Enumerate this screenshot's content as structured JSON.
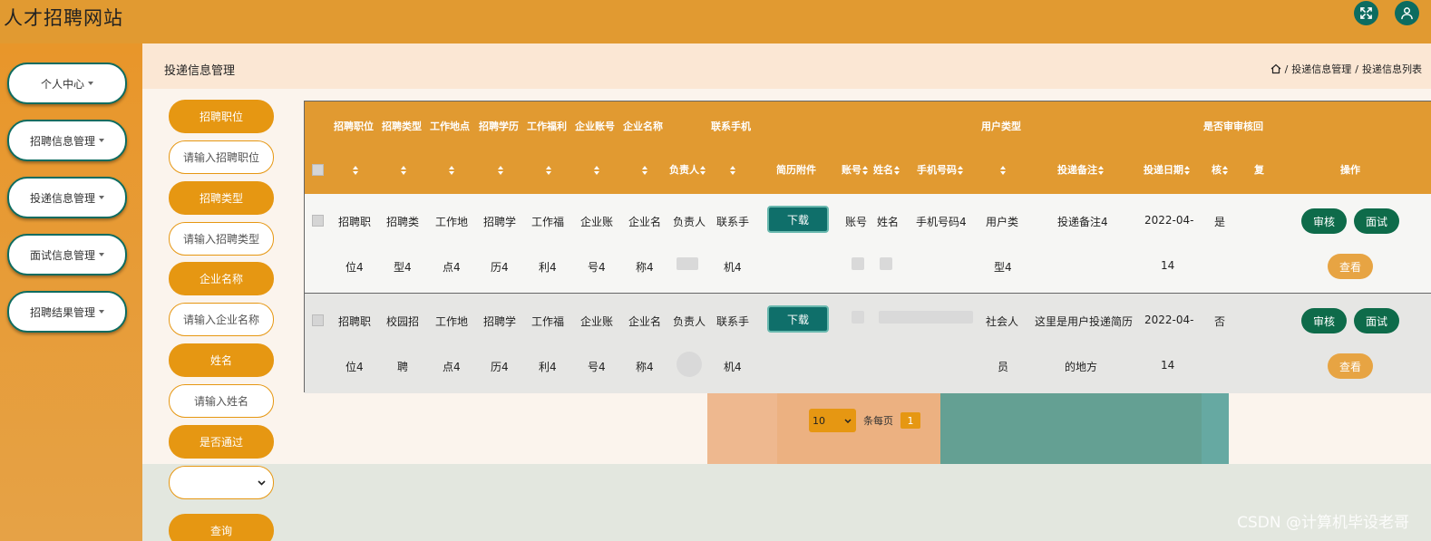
{
  "header": {
    "site_title": "人才招聘网站",
    "fullscreen_icon": "expand-icon",
    "user_icon": "user-icon"
  },
  "sidebar": {
    "items": [
      {
        "label": "个人中心"
      },
      {
        "label": "招聘信息管理"
      },
      {
        "label": "投递信息管理"
      },
      {
        "label": "面试信息管理"
      },
      {
        "label": "招聘结果管理"
      }
    ]
  },
  "page": {
    "title": "投递信息管理",
    "breadcrumb": [
      "投递信息管理",
      "投递信息列表"
    ],
    "breadcrumb_sep": "/",
    "home_icon": "home-icon"
  },
  "search": {
    "fields": [
      {
        "label": "招聘职位",
        "placeholder": "请输入招聘职位"
      },
      {
        "label": "招聘类型",
        "placeholder": "请输入招聘类型"
      },
      {
        "label": "企业名称",
        "placeholder": "请输入企业名称"
      },
      {
        "label": "姓名",
        "placeholder": "请输入姓名"
      }
    ],
    "pass_label": "是否通过",
    "pass_value": "",
    "query_button": "查询"
  },
  "table": {
    "headers_top": {
      "c1": "招聘职位",
      "c2": "招聘类型",
      "c3": "工作地点",
      "c4": "招聘学历",
      "c5": "工作福利",
      "c6": "企业账号",
      "c7": "企业名称",
      "c9": "联系手机",
      "c15": "用户类型",
      "c18": "是否审",
      "c19": "审核回"
    },
    "headers_bottom": {
      "c8": "负责人",
      "c10": "简历附件",
      "c11": "账号",
      "c12": "姓名",
      "c13": "手机号码",
      "c16": "投递备注",
      "c17": "投递日期",
      "c18": "核",
      "c19": "复",
      "c20": "操作"
    },
    "download_label": "下载",
    "actions": {
      "audit": "审核",
      "interview": "面试",
      "view": "查看"
    },
    "rows": [
      {
        "line1": [
          "招聘职",
          "招聘类",
          "工作地",
          "招聘学",
          "工作福",
          "企业账",
          "企业名",
          "负责人",
          "联系手",
          "账号",
          "姓名",
          "手机号码4",
          "用户类",
          "投递备注4",
          "2022-04-",
          "是"
        ],
        "line2": [
          "位4",
          "型4",
          "点4",
          "历4",
          "利4",
          "号4",
          "称4",
          "机4",
          "型4",
          "14"
        ]
      },
      {
        "line1": [
          "招聘职",
          "校园招",
          "工作地",
          "招聘学",
          "工作福",
          "企业账",
          "企业名",
          "负责人",
          "联系手",
          "社会人",
          "这里是用户投递简历",
          "2022-04-",
          "否"
        ],
        "line2": [
          "位4",
          "聘",
          "点4",
          "历4",
          "利4",
          "号4",
          "称4",
          "机4",
          "员",
          "的地方",
          "14"
        ]
      }
    ]
  },
  "pagination": {
    "page_size": "10",
    "per_page_label": "条每页",
    "current_page": "1"
  },
  "watermark": "CSDN @计算机毕设老哥"
}
